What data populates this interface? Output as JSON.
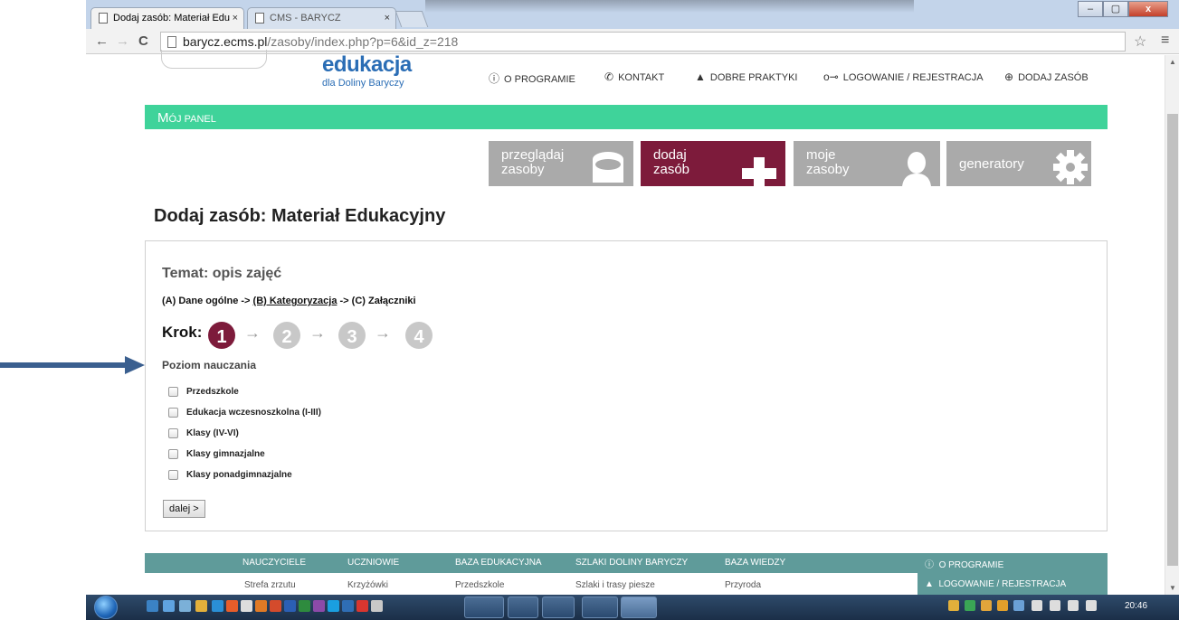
{
  "browser": {
    "tabs": [
      {
        "title": "Dodaj zasób: Materiał Edu",
        "close": "×"
      },
      {
        "title": "CMS - BARYCZ",
        "close": "×"
      }
    ],
    "window_controls": {
      "minimize": "–",
      "maximize": "▢",
      "close": "x"
    },
    "nav": {
      "back": "←",
      "forward": "→",
      "reload": "C"
    },
    "url_host": "barycz.ecms.pl",
    "url_path": "/zasoby/index.php?p=6&id_z=218",
    "star": "☆",
    "menu": "≡"
  },
  "site": {
    "logo_main": "edukacja",
    "logo_sub": "dla Doliny Baryczy",
    "topnav": [
      {
        "icon": "info-icon",
        "glyph": "ⓘ",
        "label": "O PROGRAMIE"
      },
      {
        "icon": "phone-icon",
        "glyph": "✆",
        "label": "KONTAKT"
      },
      {
        "icon": "thumbs-up-icon",
        "glyph": "▲",
        "label": "DOBRE PRAKTYKI"
      },
      {
        "icon": "key-icon",
        "glyph": "o⊸",
        "label": "LOGOWANIE / REJESTRACJA"
      },
      {
        "icon": "plus-circle-icon",
        "glyph": "⊕",
        "label": "DODAJ ZASÓB"
      }
    ],
    "panel_title_cap": "M",
    "panel_title_rest": "ÓJ PANEL",
    "tiles": [
      {
        "line1": "przeglądaj",
        "line2": "zasoby",
        "icon": "database-icon",
        "color": "#aaaaaa"
      },
      {
        "line1": "dodaj",
        "line2": "zasób",
        "icon": "plus-icon",
        "color": "#7d1b3b"
      },
      {
        "line1": "moje",
        "line2": "zasoby",
        "icon": "user-icon",
        "color": "#aaaaaa"
      },
      {
        "line1": "generatory",
        "line2": "",
        "icon": "gear-icon",
        "color": "#aaaaaa"
      }
    ]
  },
  "form": {
    "heading": "Dodaj zasób: Materiał Edukacyjny",
    "topic": "Temat: opis zajęć",
    "path_a": "(A) Dane ogólne -> ",
    "path_b": "(B) Kategoryzacja",
    "path_c": " -> (C) Załączniki",
    "krok_label": "Krok:",
    "steps": [
      {
        "num": "1",
        "active": true
      },
      {
        "num": "2",
        "active": false
      },
      {
        "num": "3",
        "active": false
      },
      {
        "num": "4",
        "active": false
      }
    ],
    "step_arrow": "→",
    "level_title": "Poziom nauczania",
    "levels": [
      "Przedszkole",
      "Edukacja wczesnoszkolna (I-III)",
      "Klasy (IV-VI)",
      "Klasy gimnazjalne",
      "Klasy ponadgimnazjalne"
    ],
    "next_button": "dalej >"
  },
  "footer": {
    "columns": [
      {
        "head": "NAUCZYCIELE",
        "sub": "Strefa zrzutu"
      },
      {
        "head": "UCZNIOWIE",
        "sub": "Krzyżówki"
      },
      {
        "head": "BAZA EDUKACYJNA",
        "sub": "Przedszkole"
      },
      {
        "head": "SZLAKI DOLINY BARYCZY",
        "sub": "Szlaki i trasy piesze"
      },
      {
        "head": "BAZA WIEDZY",
        "sub": "Przyroda"
      }
    ],
    "side_links": [
      {
        "glyph": "ⓘ",
        "label": "O PROGRAMIE"
      },
      {
        "glyph": "▲",
        "label": "LOGOWANIE / REJESTRACJA"
      }
    ]
  },
  "taskbar": {
    "clock": "20:46"
  },
  "colors": {
    "accent_green": "#3fd39a",
    "tile_active": "#7d1b3b",
    "tile_inactive": "#aaaaaa",
    "logo_blue": "#2a6db5",
    "footer_teal": "#5f9b9a",
    "pointer_arrow": "#3a5f8f"
  }
}
